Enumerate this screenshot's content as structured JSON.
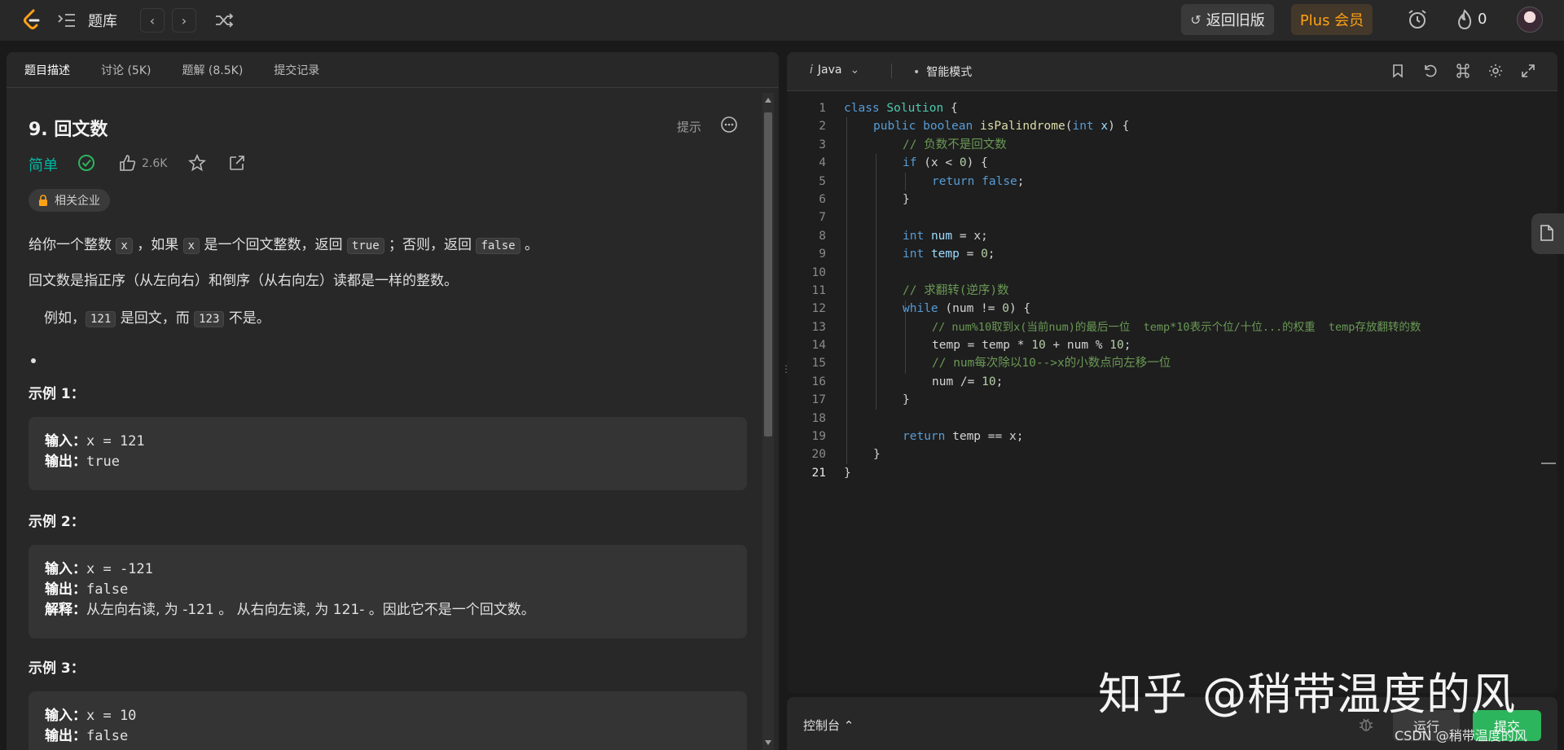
{
  "topbar": {
    "title": "题库",
    "prev_icon": "chevron-left-icon",
    "next_icon": "chevron-right-icon",
    "old_version": "返回旧版",
    "plus": "Plus 会员",
    "fire_count": "0"
  },
  "left": {
    "tabs": [
      {
        "label": "题目描述"
      },
      {
        "label": "讨论 (5K)"
      },
      {
        "label": "题解 (8.5K)"
      },
      {
        "label": "提交记录"
      }
    ],
    "title": "9. 回文数",
    "hint": "提示",
    "difficulty": "简单",
    "likes": "2.6K",
    "company": "相关企业",
    "desc1": {
      "a": "给你一个整数 ",
      "x1": "x",
      "b": " ，如果 ",
      "x2": "x",
      "c": " 是一个回文整数，返回 ",
      "t": "true",
      "d": " ；否则，返回 ",
      "f": "false",
      "e": " 。"
    },
    "desc2": "回文数是指正序（从左向右）和倒序（从右向左）读都是一样的整数。",
    "desc3": {
      "a": "例如，",
      "n1": "121",
      "b": " 是回文，而 ",
      "n2": "123",
      "c": " 不是。"
    },
    "examples": [
      {
        "title": "示例 1：",
        "in_label": "输入：",
        "input": "x = 121",
        "out_label": "输出：",
        "output": "true"
      },
      {
        "title": "示例 2：",
        "in_label": "输入：",
        "input": "x = -121",
        "out_label": "输出：",
        "output": "false",
        "exp_label": "解释：",
        "explanation": "从左向右读, 为 -121 。 从右向左读, 为 121- 。因此它不是一个回文数。"
      },
      {
        "title": "示例 3：",
        "in_label": "输入：",
        "input": "x = 10",
        "out_label": "输出：",
        "output": "false"
      }
    ]
  },
  "editor": {
    "language": "Java",
    "mode": "智能模式",
    "line_numbers": [
      "1",
      "2",
      "3",
      "4",
      "5",
      "6",
      "7",
      "8",
      "9",
      "10",
      "11",
      "12",
      "13",
      "14",
      "15",
      "16",
      "17",
      "18",
      "19",
      "20",
      "21"
    ],
    "code": {
      "l1": {
        "a": "class",
        "b": "Solution",
        "c": " {"
      },
      "l2": {
        "a": "public",
        "b": "boolean",
        "c": "isPalindrome",
        "d": "(",
        "e": "int",
        "f": "x",
        "g": ") {"
      },
      "l3": "// 负数不是回文数",
      "l4": {
        "a": "if",
        "b": " (x < ",
        "c": "0",
        "d": ") {"
      },
      "l5": {
        "a": "return",
        "b": "false",
        "c": ";"
      },
      "l6": "}",
      "l8": {
        "a": "int",
        "b": "num",
        "c": " = x;"
      },
      "l9": {
        "a": "int",
        "b": "temp",
        "c": " = ",
        "d": "0",
        "e": ";"
      },
      "l11": "// 求翻转(逆序)数",
      "l12": {
        "a": "while",
        "b": " (num != ",
        "c": "0",
        "d": ") {"
      },
      "l13": "// num%10取到x(当前num)的最后一位  temp*10表示个位/十位...的权重  temp存放翻转的数",
      "l14": {
        "a": "temp = temp * ",
        "b": "10",
        "c": " + num % ",
        "d": "10",
        "e": ";"
      },
      "l15": "// num每次除以10-->x的小数点向左移一位",
      "l16": {
        "a": "num /= ",
        "b": "10",
        "c": ";"
      },
      "l17": "}",
      "l19": {
        "a": "return",
        "b": " temp == x;"
      },
      "l20": "}",
      "l21": "}"
    }
  },
  "console": {
    "label": "控制台 ⌃",
    "run": "运行",
    "submit": "提交"
  },
  "watermark": "知乎 @稍带温度的风",
  "csdn": "CSDN @稍带温度的风",
  "colors": {
    "accent": "#ffa116",
    "easy": "#00b8a3",
    "submit": "#2db55d"
  }
}
